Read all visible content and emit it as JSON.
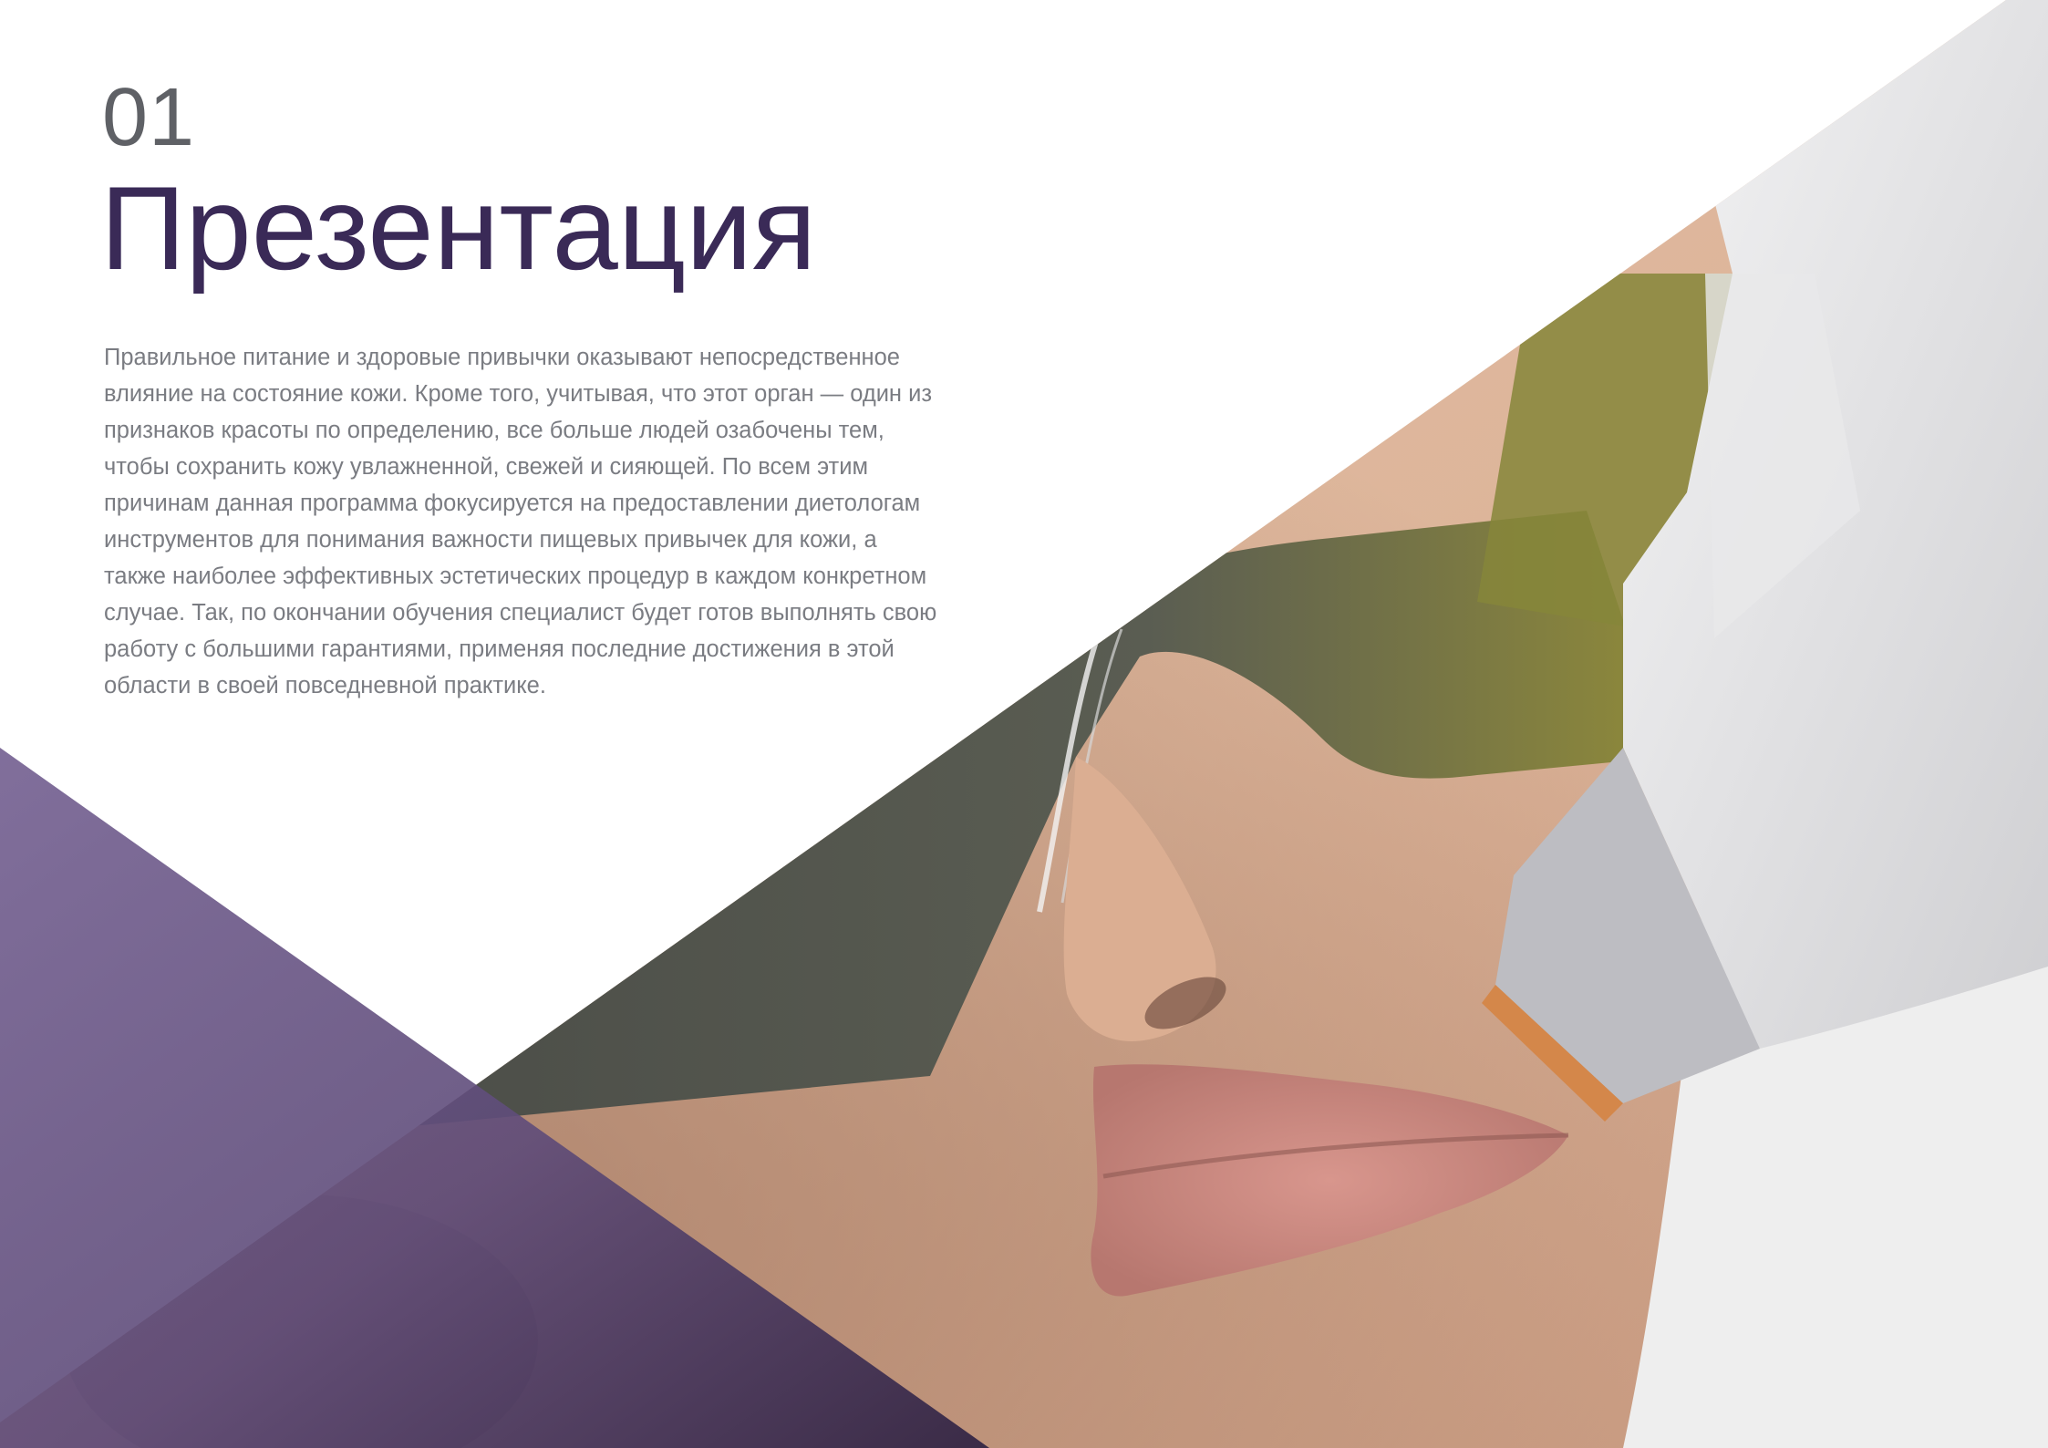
{
  "section": {
    "number": "01",
    "title": "Презентация"
  },
  "intro": {
    "text": "Правильное питание и здоровые привычки оказывают непосредственное влияние на состояние кожи. Кроме того, учитывая, что этот орган — один из признаков красоты по определению, все больше людей озабочены тем, чтобы сохранить кожу увлажненной, свежей и сияющей. По всем этим причинам данная программа фокусируется на предоставлении диетологам инструментов для понимания важности пищевых привычек для кожи, а также наиболее эффективных эстетических процедур в каждом конкретном случае. Так, по окончании обучения специалист будет готов выполнять свою работу с большими гарантиями, применяя последние достижения в этой области в своей повседневной практике."
  },
  "colors": {
    "title": "#3a2a57",
    "number": "#5f6166",
    "body_text": "#7a7c82",
    "purple_overlay": "#6e5a8f"
  },
  "illustration": {
    "subject": "woman-face-with-protective-glasses-laser-treatment"
  }
}
